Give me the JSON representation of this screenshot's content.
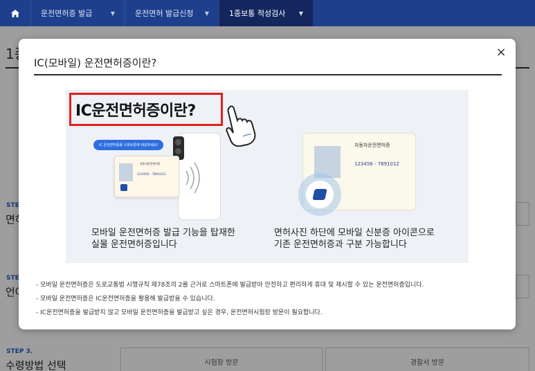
{
  "nav": {
    "items": [
      {
        "label": "운전면허증 발급"
      },
      {
        "label": "운전면허 발급신청"
      },
      {
        "label": "1종보통 적성검사"
      }
    ]
  },
  "page": {
    "title": "1종",
    "steps": [
      {
        "step": "STEP",
        "name": "면허"
      },
      {
        "step": "STEP",
        "name": "언어"
      },
      {
        "step": "STEP 3.",
        "name": "수령방법 선택"
      }
    ],
    "options": [
      "시험장 방문",
      "경찰서 방문"
    ]
  },
  "modal": {
    "title": "IC(모바일) 운전면허증이란?",
    "close_label": "×",
    "headline": "IC운전면허증이란?",
    "bubble": "IC 운전면허증을 스마트폰에 태깅하세요!",
    "card_small_title": "자동차운전면허증",
    "card_number": "123456 - 7891012",
    "card_big_title": "자동차운전면허증",
    "caption_left": [
      "모바일 운전면허증 발급 기능을 탑재한",
      "실물 운전면허증입니다"
    ],
    "caption_right": [
      "면허사진 하단에 모바일 신분증 아이콘으로",
      "기존 운전면허증과 구분 가능합니다"
    ],
    "notes": [
      "- 모바일 운전면허증은 도로교통법 시행규칙 제78조의 2를 근거로 스마트폰에 발급받아 안전하고 편리하게 휴대 및 제시할 수 있는 운전면허증입니다.",
      "- 모바일 운전면허증은 IC운전면허증을 활용해 발급받을 수 있습니다.",
      "- IC운전면허증을 발급받지 않고 모바일 운전면허증을 발급받고 싶은 경우, 운전면허시험장 방문이 필요합니다."
    ]
  },
  "colors": {
    "nav": "#1d3f8c",
    "nav_active": "#13275e",
    "highlight": "#e02020",
    "banner_bg": "#eef1f5"
  }
}
